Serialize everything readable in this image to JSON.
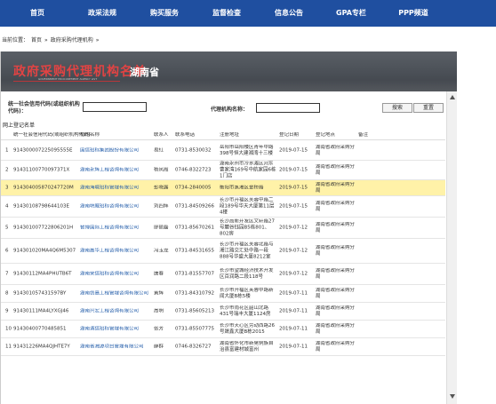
{
  "nav": [
    "首页",
    "政采法规",
    "购买服务",
    "监督检查",
    "信息公告",
    "GPA专栏",
    "PPP频道"
  ],
  "breadcrumb": {
    "prefix": "当前位置：",
    "home": "首页",
    "sep1": "»",
    "current": "政府采购代理机构",
    "sep2": "»"
  },
  "banner": {
    "title": "政府采购代理机构名单",
    "province": "湖南省",
    "subtitle": "GOVERNMENT PROCUREMENT AGENCY LIST"
  },
  "search": {
    "credit_label": "统一社会信用代码(或组织机构代码)：",
    "name_label": "代理机构名称：",
    "credit_value": "",
    "name_value": "",
    "search_button": "搜索",
    "reset_button": "重置"
  },
  "grid_title": "网上登记名单",
  "headers": [
    "统一社会信用代码(或组织机构代码)",
    "机构名称",
    "联系人",
    "联系电话",
    "注册地址",
    "登记日期",
    "登记地点",
    "备注"
  ],
  "rows": [
    {
      "no": "1",
      "code": "914300007225095555E",
      "name": "国信招标集团股份有限公司",
      "contact": "易红",
      "phone": "0731-8530032",
      "address": "岳阳市岳阳楼区青年中路398号恒大建湘湾十三楼",
      "date": "2019-07-15",
      "place": "湖南省政府采购分局",
      "note": ""
    },
    {
      "no": "2",
      "code": "91431100770097371X",
      "name": "湖南永辉工程咨询有限公司",
      "contact": "杨凤霞",
      "phone": "0746-8322723",
      "address": "湖南永州市冷水滩区河东曹家湾169号中航家园6栋1门店",
      "date": "2019-07-15",
      "place": "湖南省政府采购分局",
      "note": ""
    },
    {
      "no": "3",
      "code": "914304005870247720M",
      "name": "湖南海城招标管理有限公司",
      "contact": "彭晓露",
      "phone": "0734-2840005",
      "address": "衡阳市蒸湘区金桥路",
      "date": "2019-07-15",
      "place": "湖南省政府采购分局",
      "note": ""
    },
    {
      "no": "4",
      "code": "91430108798644103E",
      "name": "湖南明威招标咨询有限公司",
      "contact": "刘四辉",
      "phone": "0731-84509266",
      "address": "长沙市开福区芙蓉中路二段189号华天大厦第11层4楼",
      "date": "2019-07-15",
      "place": "湖南省政府采购分局",
      "note": ""
    },
    {
      "no": "5",
      "code": "914301007722806201H",
      "name": "智博国际工程咨询有限公司",
      "contact": "廖振磊",
      "phone": "0731-85670261",
      "address": "长沙高新开发区文轩路27号麓谷钰园B5栋801、802房",
      "date": "2019-07-12",
      "place": "湖南省政府采购分局",
      "note": ""
    },
    {
      "no": "6",
      "code": "914301020MA4Q6M5307",
      "name": "湖南鑫华工程咨询有限公司",
      "contact": "冯玉龙",
      "phone": "0731-84531655",
      "address": "长沙市开福区芙蓉北路与湘江路交汇处中路一段888号华盛大厦8212室",
      "date": "2019-07-12",
      "place": "湖南省政府采购分局",
      "note": ""
    },
    {
      "no": "7",
      "code": "91430112MA4PHUTB6T",
      "name": "湖南荣信招标咨询有限公司",
      "contact": "唐春",
      "phone": "0731-81557707",
      "address": "长沙市望城经济技术开发区百润路二段118号",
      "date": "2019-07-12",
      "place": "湖南省政府采购分局",
      "note": ""
    },
    {
      "no": "8",
      "code": "914301057431597BY",
      "name": "湖南创嘉工程管理咨询有限公司",
      "contact": "黄辉",
      "phone": "0731-84310792",
      "address": "长沙市开福区芙蓉中路新闻大厦B栋5楼",
      "date": "2019-07-11",
      "place": "湖南省政府采购分局",
      "note": ""
    },
    {
      "no": "9",
      "code": "91430111MA4LYXGJ46",
      "name": "湖南兴宏工程咨询有限公司",
      "contact": "周明",
      "phone": "0731-85605213",
      "address": "长沙市雨花区韶山北路431号瑞丰大厦1124房",
      "date": "2019-07-11",
      "place": "湖南省政府采购分局",
      "note": ""
    },
    {
      "no": "10",
      "code": "91430400770485851",
      "name": "湖南诚信招标管理有限公司",
      "contact": "张芳",
      "phone": "0731-85507775",
      "address": "长沙市天心区劳动西路26号晟鑫大厦B栋2015",
      "date": "2019-07-11",
      "place": "湖南省政府采购分局",
      "note": ""
    },
    {
      "no": "11",
      "code": "91431226MA4QJHTE7Y",
      "name": "湖南省湘源项目管理有限公司",
      "contact": "薛群",
      "phone": "0746-8326727",
      "address": "湖南省怀化市新晃侗族自治县富建材城富州",
      "date": "2019-07-11",
      "place": "湖南省政府采购分局",
      "note": ""
    }
  ],
  "colors": {
    "nav_bg": "#1f4fa0",
    "banner_title": "#e24343",
    "link": "#1f5aa8",
    "highlight_row": "#fff2a8"
  }
}
